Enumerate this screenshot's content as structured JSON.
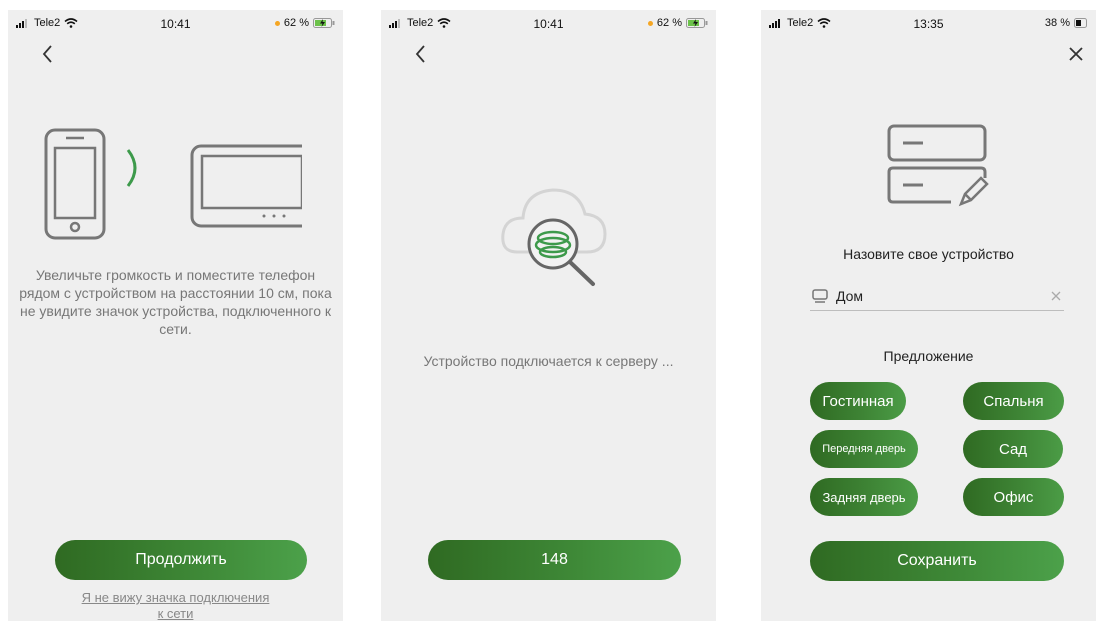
{
  "screens": [
    {
      "status": {
        "carrier": "Tele2",
        "time": "10:41",
        "battery": "62 %"
      },
      "instruction": "Увеличьте громкость и поместите телефон рядом с устройством на расстоянии 10 см, пока не увидите значок устройства, подключенного к сети.",
      "continue_label": "Продолжить",
      "link_line1": "Я не вижу значка подключения",
      "link_line2": "к сети"
    },
    {
      "status": {
        "carrier": "Tele2",
        "time": "10:41",
        "battery": "62 %"
      },
      "progress_text": "Устройство подключается к серверу ...",
      "countdown_label": "148"
    },
    {
      "status": {
        "carrier": "Tele2",
        "time": "13:35",
        "battery": "38 %"
      },
      "name_prompt": "Назовите свое устройство",
      "name_value": "Дом",
      "suggestion_title": "Предложение",
      "suggestions": [
        "Гостинная",
        "Спальня",
        "Передняя дверь",
        "Сад",
        "Задняя дверь",
        "Офис"
      ],
      "save_label": "Сохранить"
    }
  ],
  "colors": {
    "accent_dark": "#2f6a22",
    "accent_light": "#4ca14a",
    "indicator": "#f5a623"
  }
}
